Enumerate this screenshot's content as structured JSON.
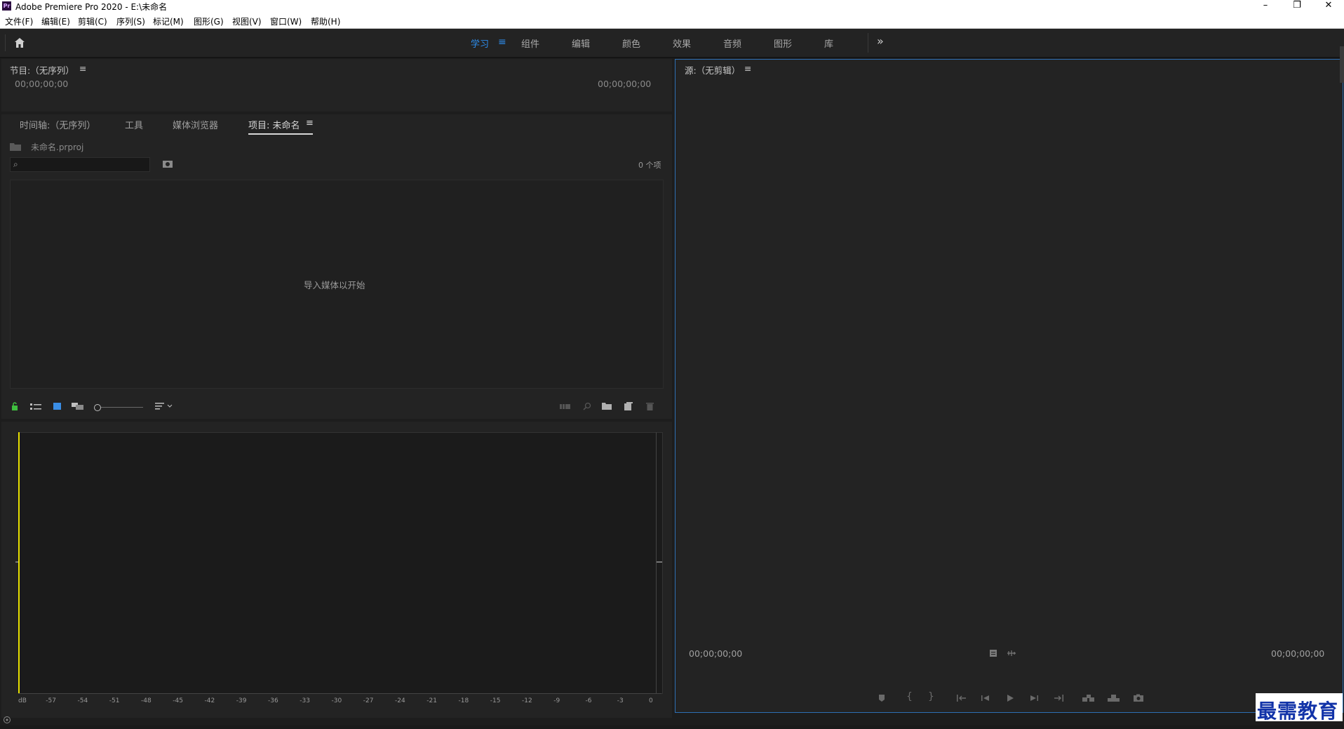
{
  "window": {
    "title": "Adobe Premiere Pro 2020 - E:\\未命名",
    "app_icon": "Pr"
  },
  "menu": [
    "文件(F)",
    "编辑(E)",
    "剪辑(C)",
    "序列(S)",
    "标记(M)",
    "图形(G)",
    "视图(V)",
    "窗口(W)",
    "帮助(H)"
  ],
  "workspaces": {
    "tabs": [
      "学习",
      "组件",
      "编辑",
      "颜色",
      "效果",
      "音频",
      "图形",
      "库"
    ],
    "active": "学习",
    "menu_icon": "≡",
    "overflow_icon": "»"
  },
  "program_monitor": {
    "title": "节目:（无序列）",
    "timecode_left": "00;00;00;00",
    "timecode_right": "00;00;00;00"
  },
  "project_panel": {
    "tabs": [
      "时间轴:（无序列）",
      "工具",
      "媒体浏览器",
      "项目: 未命名"
    ],
    "active_tab": "项目: 未命名",
    "file_name": "未命名.prproj",
    "item_count": "0 个项",
    "empty_message": "导入媒体以开始"
  },
  "audio_meter": {
    "scale": [
      "dB",
      "-57",
      "-54",
      "-51",
      "-48",
      "-45",
      "-42",
      "-39",
      "-36",
      "-33",
      "-30",
      "-27",
      "-24",
      "-21",
      "-18",
      "-15",
      "-12",
      "-9",
      "-6",
      "-3",
      "0"
    ]
  },
  "source_monitor": {
    "title": "源:（无剪辑）",
    "timecode_left": "00;00;00;00",
    "timecode_right": "00;00;00;00"
  },
  "watermark": "最需教育",
  "colors": {
    "accent": "#2d8ceb",
    "panel_bg": "#232323",
    "playhead": "#e8e000",
    "focus_border": "#2d6fb3"
  }
}
